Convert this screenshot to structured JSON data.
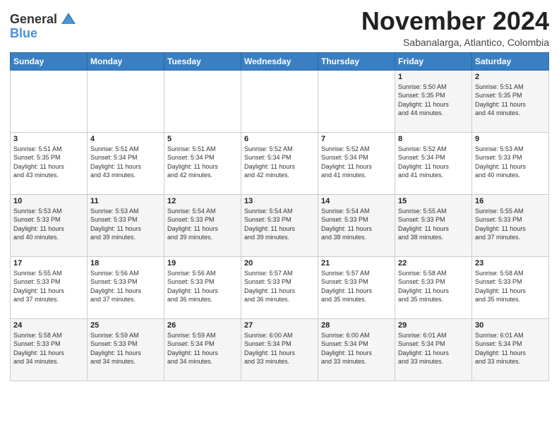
{
  "header": {
    "logo_line1": "General",
    "logo_line2": "Blue",
    "month": "November 2024",
    "location": "Sabanalarga, Atlantico, Colombia"
  },
  "weekdays": [
    "Sunday",
    "Monday",
    "Tuesday",
    "Wednesday",
    "Thursday",
    "Friday",
    "Saturday"
  ],
  "weeks": [
    [
      {
        "day": "",
        "info": ""
      },
      {
        "day": "",
        "info": ""
      },
      {
        "day": "",
        "info": ""
      },
      {
        "day": "",
        "info": ""
      },
      {
        "day": "",
        "info": ""
      },
      {
        "day": "1",
        "info": "Sunrise: 5:50 AM\nSunset: 5:35 PM\nDaylight: 11 hours\nand 44 minutes."
      },
      {
        "day": "2",
        "info": "Sunrise: 5:51 AM\nSunset: 5:35 PM\nDaylight: 11 hours\nand 44 minutes."
      }
    ],
    [
      {
        "day": "3",
        "info": "Sunrise: 5:51 AM\nSunset: 5:35 PM\nDaylight: 11 hours\nand 43 minutes."
      },
      {
        "day": "4",
        "info": "Sunrise: 5:51 AM\nSunset: 5:34 PM\nDaylight: 11 hours\nand 43 minutes."
      },
      {
        "day": "5",
        "info": "Sunrise: 5:51 AM\nSunset: 5:34 PM\nDaylight: 11 hours\nand 42 minutes."
      },
      {
        "day": "6",
        "info": "Sunrise: 5:52 AM\nSunset: 5:34 PM\nDaylight: 11 hours\nand 42 minutes."
      },
      {
        "day": "7",
        "info": "Sunrise: 5:52 AM\nSunset: 5:34 PM\nDaylight: 11 hours\nand 41 minutes."
      },
      {
        "day": "8",
        "info": "Sunrise: 5:52 AM\nSunset: 5:34 PM\nDaylight: 11 hours\nand 41 minutes."
      },
      {
        "day": "9",
        "info": "Sunrise: 5:53 AM\nSunset: 5:33 PM\nDaylight: 11 hours\nand 40 minutes."
      }
    ],
    [
      {
        "day": "10",
        "info": "Sunrise: 5:53 AM\nSunset: 5:33 PM\nDaylight: 11 hours\nand 40 minutes."
      },
      {
        "day": "11",
        "info": "Sunrise: 5:53 AM\nSunset: 5:33 PM\nDaylight: 11 hours\nand 39 minutes."
      },
      {
        "day": "12",
        "info": "Sunrise: 5:54 AM\nSunset: 5:33 PM\nDaylight: 11 hours\nand 39 minutes."
      },
      {
        "day": "13",
        "info": "Sunrise: 5:54 AM\nSunset: 5:33 PM\nDaylight: 11 hours\nand 39 minutes."
      },
      {
        "day": "14",
        "info": "Sunrise: 5:54 AM\nSunset: 5:33 PM\nDaylight: 11 hours\nand 38 minutes."
      },
      {
        "day": "15",
        "info": "Sunrise: 5:55 AM\nSunset: 5:33 PM\nDaylight: 11 hours\nand 38 minutes."
      },
      {
        "day": "16",
        "info": "Sunrise: 5:55 AM\nSunset: 5:33 PM\nDaylight: 11 hours\nand 37 minutes."
      }
    ],
    [
      {
        "day": "17",
        "info": "Sunrise: 5:55 AM\nSunset: 5:33 PM\nDaylight: 11 hours\nand 37 minutes."
      },
      {
        "day": "18",
        "info": "Sunrise: 5:56 AM\nSunset: 5:33 PM\nDaylight: 11 hours\nand 37 minutes."
      },
      {
        "day": "19",
        "info": "Sunrise: 5:56 AM\nSunset: 5:33 PM\nDaylight: 11 hours\nand 36 minutes."
      },
      {
        "day": "20",
        "info": "Sunrise: 5:57 AM\nSunset: 5:33 PM\nDaylight: 11 hours\nand 36 minutes."
      },
      {
        "day": "21",
        "info": "Sunrise: 5:57 AM\nSunset: 5:33 PM\nDaylight: 11 hours\nand 35 minutes."
      },
      {
        "day": "22",
        "info": "Sunrise: 5:58 AM\nSunset: 5:33 PM\nDaylight: 11 hours\nand 35 minutes."
      },
      {
        "day": "23",
        "info": "Sunrise: 5:58 AM\nSunset: 5:33 PM\nDaylight: 11 hours\nand 35 minutes."
      }
    ],
    [
      {
        "day": "24",
        "info": "Sunrise: 5:58 AM\nSunset: 5:33 PM\nDaylight: 11 hours\nand 34 minutes."
      },
      {
        "day": "25",
        "info": "Sunrise: 5:59 AM\nSunset: 5:33 PM\nDaylight: 11 hours\nand 34 minutes."
      },
      {
        "day": "26",
        "info": "Sunrise: 5:59 AM\nSunset: 5:34 PM\nDaylight: 11 hours\nand 34 minutes."
      },
      {
        "day": "27",
        "info": "Sunrise: 6:00 AM\nSunset: 5:34 PM\nDaylight: 11 hours\nand 33 minutes."
      },
      {
        "day": "28",
        "info": "Sunrise: 6:00 AM\nSunset: 5:34 PM\nDaylight: 11 hours\nand 33 minutes."
      },
      {
        "day": "29",
        "info": "Sunrise: 6:01 AM\nSunset: 5:34 PM\nDaylight: 11 hours\nand 33 minutes."
      },
      {
        "day": "30",
        "info": "Sunrise: 6:01 AM\nSunset: 5:34 PM\nDaylight: 11 hours\nand 33 minutes."
      }
    ]
  ]
}
